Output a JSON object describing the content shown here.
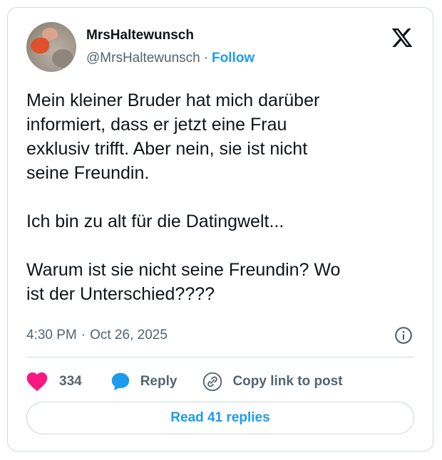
{
  "author": {
    "display_name": "MrsHaltewunsch",
    "handle": "@MrsHaltewunsch",
    "separator": "·",
    "follow_label": "Follow"
  },
  "tweet": {
    "text": "Mein kleiner Bruder hat mich darüber\ninformiert, dass er jetzt eine Frau\nexklusiv trifft. Aber nein, sie ist nicht\nseine Freundin.\n\nIch bin zu alt für die Datingwelt...\n\nWarum ist sie nicht seine Freundin? Wo\nist der Unterschied????",
    "time": "4:30 PM",
    "separator": "·",
    "date": "Oct 26, 2025"
  },
  "actions": {
    "like_count": "334",
    "reply_label": "Reply",
    "copy_link_label": "Copy link to post"
  },
  "read_replies_label": "Read 41 replies",
  "icons": {
    "brand": "x-logo-icon",
    "info": "info-icon",
    "like": "heart-icon",
    "reply": "speech-bubble-icon",
    "copy": "link-icon"
  },
  "colors": {
    "accent": "#1d9bf0",
    "like": "#f91880",
    "text": "#0f1419",
    "secondary": "#536471",
    "border": "#cfd9de"
  }
}
